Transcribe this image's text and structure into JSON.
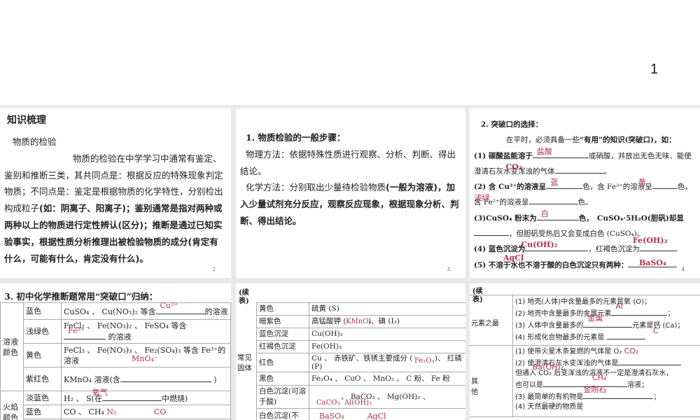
{
  "page_number": "1",
  "p1": {
    "title": "知识梳理",
    "subtitle": "物质的检验",
    "para_plain": "物质的检验在中学学习中通常有鉴定、鉴别和推断三类，其共同点是：根据反应的特殊现象判定物质；不同点是：鉴定是根据物质的化学特性，分别检出构成粒子",
    "para_bold": "(如：阴离子、阳离子)；鉴别通常是指对两种或两种以上的物质进行定性辨认(区分)；推断是通过已知实验事实，根据性质分析推理出被检验物质的成分(肯定有什么，可能有什么，肯定没有什么)。",
    "num": "2"
  },
  "p2": {
    "heading": "1. 物质检验的一般步骤：",
    "physical": "物理方法：依据特殊性质进行观察、分析、判断、得出结论。",
    "chem_plain": "化学方法：分别取出少量待检验物质",
    "chem_bold": "(一般为溶液)，加入少量试剂充分反应，观察反应现象，根据现象分析、判断、得出结论。",
    "num": "3"
  },
  "p3": {
    "heading": "2. 突破口的选择：",
    "intro_a": "在平时，必须具备一些",
    "intro_b": "“有用”的知识(突破口)，如：",
    "l1a": "(1) 碳酸盐能溶于",
    "l1b": "或硝酸，并放出无色无味、能使澄清石灰水变浑浊的气体",
    "l1c": "。",
    "l2a": "(2) 含 Cu²⁺的溶液呈",
    "l2b": "色，含 Fe³⁺的溶液呈",
    "l2c": "色，含 Fe²⁺的溶液呈",
    "l2d": "色。",
    "l3a": "(3)CuSO₄ 粉末为",
    "l3b": "色，　CuSO₄·5H₂O(胆矾)却显",
    "l3c": "，但胆矾受热后又会变成白色 (CuSO₄)。",
    "l4a": "(4) 蓝色沉淀为",
    "l4b": "，红褐色沉淀为",
    "l4c": "。",
    "l5": "(5) 不溶于水也不溶于酸的白色沉淀只有两种：",
    "ans": {
      "hcl": "盐酸",
      "co2": "CO₂",
      "blue": "蓝",
      "yellow": "黄",
      "lightgreen": "浅绿",
      "white": "白",
      "bluec": "蓝",
      "cuoh": "Cu(OH)₂",
      "feoh": "Fe(OH)₃",
      "baso4": "BaSO₄",
      "agcl": "AgCl"
    },
    "num": "4"
  },
  "p4": {
    "title": "3. 初中化学推断题常用“突破口”归纳：",
    "g1": "溶液颜色",
    "rows1": [
      {
        "c": "蓝色",
        "d": "CuSO₄ 、 Cu(NO₃)₂ 等含",
        "a": "Cu²⁺",
        "e": "的溶液"
      },
      {
        "c": "浅绿色",
        "d": "FeCl₂ 、 Fe(NO₃)₂ 、 FeSO₄ 等含",
        "a": "Fe²⁺",
        "e": "的溶液"
      },
      {
        "c": "黄色",
        "d": "FeCl₃ 、 Fe(NO₃)₃ 、 Fe₂(SO₄)₃ 等含 Fe³⁺的溶液",
        "a": "MnO₄⁻",
        "e": ""
      },
      {
        "c": "紫红色",
        "d": "KMnO₄ 溶液(含",
        "a": "",
        "e": ")"
      }
    ],
    "g2": "火焰颜色",
    "rows2": [
      {
        "c": "淡蓝色",
        "d": "H₂ 、 S(在",
        "a": "氧气",
        "e": "中燃烧)"
      },
      {
        "c": "蓝色",
        "d": "CO 、 CH₄",
        "a": "N₂",
        "e": "CO"
      }
    ]
  },
  "p5": {
    "caption": "(续表)",
    "group": "常见固体",
    "rows": [
      {
        "c": "黄色",
        "d": "硫黄 (S)",
        "a": ""
      },
      {
        "c": "暗紫色",
        "d": "高锰酸钾 (　　　)、碘 (I₂)",
        "a": "KMnO₄"
      },
      {
        "c": "蓝色沉淀",
        "d": "Cu(OH)₂",
        "a": ""
      },
      {
        "c": "红褐色沉淀",
        "d": "Fe(OH)₃",
        "a": ""
      },
      {
        "c": "红色",
        "d": "Cu 、 赤铁矿、铁锈主要成分 (　　　)、 红磷 (P)",
        "a": "Fe₂O₃"
      },
      {
        "c": "黑色",
        "d": "Fe₃O₄ 、 CuO 、 MnO₂ 、 C 粉、 Fe 粉",
        "a": ""
      },
      {
        "c": "白色沉淀(可溶于酸)",
        "d": "　　　　、 BaCO₃ 、 Mg(OH)₂ 、",
        "a": "CaCO₃  Al(OH)₃"
      },
      {
        "c": "白色沉淀(不",
        "d": "",
        "a": "BaSO₄　　　AgCl"
      }
    ]
  },
  "p6": {
    "caption": "(续表)",
    "g1": "元素之最",
    "items1": [
      "(1) 地壳(人体)中含量最多的元素是氧 (O)；",
      "(2) 地壳中含量最多的金属元素",
      "(3) 人体中含量最多的",
      "元素是钙 (Ca)；",
      "(4) 形成化合物最多的元素是"
    ],
    "g2": "其　他",
    "items2": [
      "(1) 使带火星木条复燃的气体是 O₂",
      "(2) 使澄清石灰水变浑浊的气体是",
      "但通入 CO₂ 后变浑浊的溶液不一定是澄清石灰水，",
      "也可以是",
      "溶液；",
      "(3) 最简单的有机物是",
      "(4) 天然最硬的物质是"
    ],
    "ans": {
      "al": "Al",
      "metal": "金属",
      "c": "C",
      "co2": "CO₂",
      "baoh": "Ba(OH)₂",
      "ch4": "CH₄",
      "diamond": "金刚石"
    }
  }
}
